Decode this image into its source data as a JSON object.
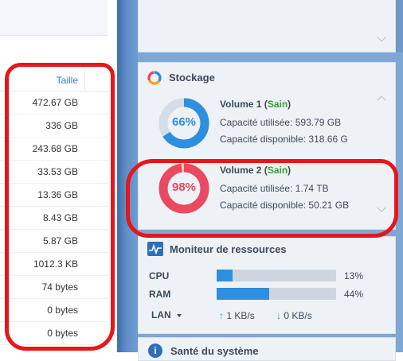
{
  "file_list": {
    "size_header": "Taille",
    "sizes": [
      "472.67 GB",
      "336 GB",
      "243.68 GB",
      "33.53 GB",
      "13.36 GB",
      "8.43 GB",
      "5.87 GB",
      "1012.3 KB",
      "74 bytes",
      "0 bytes",
      "0 bytes"
    ]
  },
  "storage": {
    "title": "Stockage",
    "used_label": "Capacité utilisée:",
    "free_label": "Capacité disponible:",
    "volumes": [
      {
        "name": "Volume 1",
        "status": "Sain",
        "percent_text": "66%",
        "percent": 66,
        "used": "593.79 GB",
        "free": "318.66 G",
        "color": "#2d8fe0"
      },
      {
        "name": "Volume 2",
        "status": "Sain",
        "percent_text": "98%",
        "percent": 98,
        "used": "1.74 TB",
        "free": "50.21 GB",
        "color": "#e84a5f"
      }
    ]
  },
  "resource_monitor": {
    "title": "Moniteur de ressources",
    "cpu_label": "CPU",
    "cpu_value": "13%",
    "cpu_fraction": 0.13,
    "ram_label": "RAM",
    "ram_value": "44%",
    "ram_fraction": 0.44,
    "lan_label": "LAN",
    "lan_up": "1 KB/s",
    "lan_down": "0 KB/s"
  },
  "system_health": {
    "title": "Santé du système"
  },
  "colors": {
    "annotation": "#e8151a",
    "accent": "#2d8fe0",
    "healthy": "#2ea52e",
    "warning": "#e84a5f"
  }
}
